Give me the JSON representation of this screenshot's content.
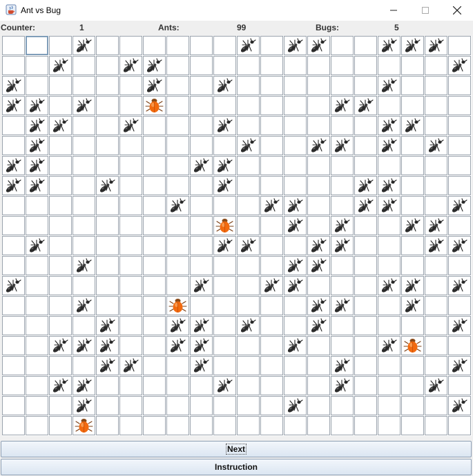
{
  "window": {
    "title": "Ant vs Bug",
    "icon": "java-cup-icon"
  },
  "status": {
    "counter_label": "Counter:",
    "counter_value": "1",
    "ants_label": "Ants:",
    "ants_value": "99",
    "bugs_label": "Bugs:",
    "bugs_value": "5"
  },
  "grid": {
    "rows": 20,
    "cols": 20,
    "selected_cell": [
      0,
      1
    ],
    "ants": [
      [
        0,
        3
      ],
      [
        0,
        10
      ],
      [
        0,
        12
      ],
      [
        0,
        13
      ],
      [
        0,
        16
      ],
      [
        0,
        17
      ],
      [
        0,
        18
      ],
      [
        1,
        2
      ],
      [
        1,
        5
      ],
      [
        1,
        6
      ],
      [
        1,
        19
      ],
      [
        2,
        0
      ],
      [
        2,
        6
      ],
      [
        2,
        9
      ],
      [
        2,
        16
      ],
      [
        3,
        0
      ],
      [
        3,
        1
      ],
      [
        3,
        3
      ],
      [
        3,
        14
      ],
      [
        3,
        15
      ],
      [
        4,
        1
      ],
      [
        4,
        2
      ],
      [
        4,
        5
      ],
      [
        4,
        9
      ],
      [
        4,
        16
      ],
      [
        4,
        17
      ],
      [
        5,
        1
      ],
      [
        5,
        10
      ],
      [
        5,
        13
      ],
      [
        5,
        14
      ],
      [
        5,
        16
      ],
      [
        5,
        18
      ],
      [
        6,
        0
      ],
      [
        6,
        1
      ],
      [
        6,
        8
      ],
      [
        6,
        9
      ],
      [
        7,
        0
      ],
      [
        7,
        1
      ],
      [
        7,
        4
      ],
      [
        7,
        9
      ],
      [
        7,
        15
      ],
      [
        7,
        16
      ],
      [
        8,
        7
      ],
      [
        8,
        11
      ],
      [
        8,
        12
      ],
      [
        8,
        15
      ],
      [
        8,
        16
      ],
      [
        8,
        19
      ],
      [
        9,
        12
      ],
      [
        9,
        14
      ],
      [
        9,
        17
      ],
      [
        9,
        18
      ],
      [
        10,
        1
      ],
      [
        10,
        9
      ],
      [
        10,
        10
      ],
      [
        10,
        13
      ],
      [
        10,
        14
      ],
      [
        10,
        18
      ],
      [
        10,
        19
      ],
      [
        11,
        3
      ],
      [
        11,
        12
      ],
      [
        11,
        13
      ],
      [
        12,
        0
      ],
      [
        12,
        8
      ],
      [
        12,
        11
      ],
      [
        12,
        12
      ],
      [
        12,
        16
      ],
      [
        12,
        17
      ],
      [
        12,
        19
      ],
      [
        13,
        3
      ],
      [
        13,
        13
      ],
      [
        13,
        14
      ],
      [
        13,
        17
      ],
      [
        14,
        4
      ],
      [
        14,
        7
      ],
      [
        14,
        8
      ],
      [
        14,
        10
      ],
      [
        14,
        13
      ],
      [
        14,
        19
      ],
      [
        15,
        2
      ],
      [
        15,
        3
      ],
      [
        15,
        4
      ],
      [
        15,
        7
      ],
      [
        15,
        8
      ],
      [
        15,
        12
      ],
      [
        15,
        16
      ],
      [
        16,
        4
      ],
      [
        16,
        5
      ],
      [
        16,
        8
      ],
      [
        16,
        14
      ],
      [
        16,
        19
      ],
      [
        17,
        2
      ],
      [
        17,
        3
      ],
      [
        17,
        9
      ],
      [
        17,
        14
      ],
      [
        17,
        18
      ],
      [
        18,
        3
      ],
      [
        18,
        12
      ],
      [
        18,
        19
      ]
    ],
    "bugs": [
      [
        3,
        6
      ],
      [
        9,
        9
      ],
      [
        13,
        7
      ],
      [
        15,
        17
      ],
      [
        19,
        3
      ]
    ]
  },
  "buttons": {
    "next": "Next",
    "instruction": "Instruction"
  }
}
